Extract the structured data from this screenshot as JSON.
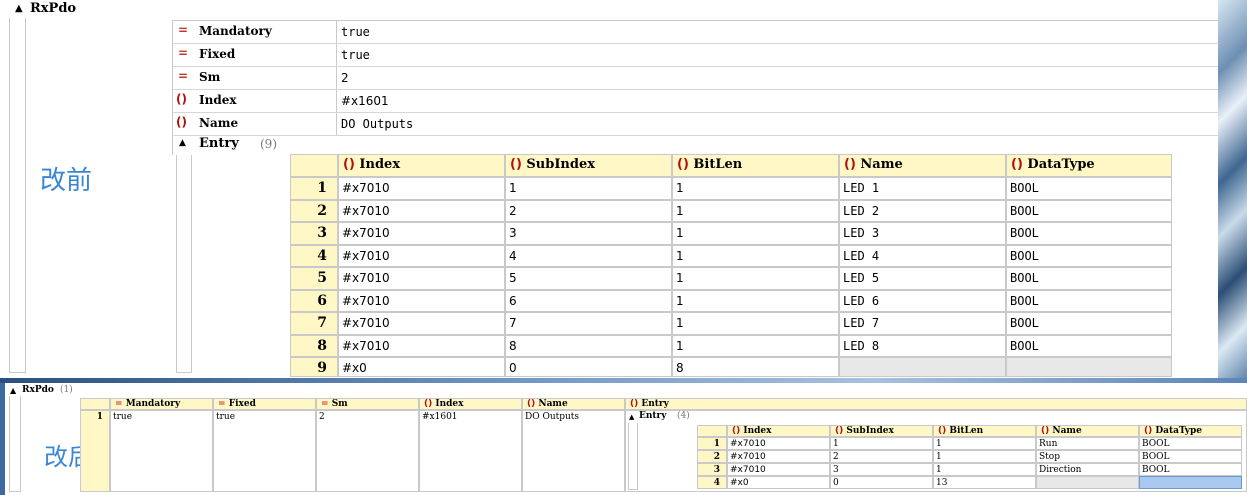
{
  "top": {
    "node_label": "RxPdo",
    "props": [
      {
        "icon": "=",
        "key": "Mandatory",
        "value": "true"
      },
      {
        "icon": "=",
        "key": "Fixed",
        "value": "true"
      },
      {
        "icon": "=",
        "key": "Sm",
        "value": "2"
      },
      {
        "icon": "()",
        "key": "Index",
        "value": "#x1601"
      },
      {
        "icon": "()",
        "key": "Name",
        "value": "DO Outputs"
      }
    ],
    "entry_label": "Entry",
    "entry_count": "(9)",
    "annotation": "改前",
    "columns": [
      "Index",
      "SubIndex",
      "BitLen",
      "Name",
      "DataType"
    ],
    "rows": [
      {
        "n": "1",
        "index": "#x7010",
        "sub": "1",
        "bitlen": "1",
        "name": "LED 1",
        "type": "BOOL"
      },
      {
        "n": "2",
        "index": "#x7010",
        "sub": "2",
        "bitlen": "1",
        "name": "LED 2",
        "type": "BOOL"
      },
      {
        "n": "3",
        "index": "#x7010",
        "sub": "3",
        "bitlen": "1",
        "name": "LED 3",
        "type": "BOOL"
      },
      {
        "n": "4",
        "index": "#x7010",
        "sub": "4",
        "bitlen": "1",
        "name": "LED 4",
        "type": "BOOL"
      },
      {
        "n": "5",
        "index": "#x7010",
        "sub": "5",
        "bitlen": "1",
        "name": "LED 5",
        "type": "BOOL"
      },
      {
        "n": "6",
        "index": "#x7010",
        "sub": "6",
        "bitlen": "1",
        "name": "LED 6",
        "type": "BOOL"
      },
      {
        "n": "7",
        "index": "#x7010",
        "sub": "7",
        "bitlen": "1",
        "name": "LED 7",
        "type": "BOOL"
      },
      {
        "n": "8",
        "index": "#x7010",
        "sub": "8",
        "bitlen": "1",
        "name": "LED 8",
        "type": "BOOL"
      },
      {
        "n": "9",
        "index": "#x0",
        "sub": "0",
        "bitlen": "8",
        "name": "",
        "type": ""
      }
    ]
  },
  "bottom": {
    "node_label": "RxPdo",
    "node_count": "(1)",
    "columns": [
      "Mandatory",
      "Fixed",
      "Sm",
      "Index",
      "Name",
      "Entry"
    ],
    "row": {
      "n": "1",
      "mandatory": "true",
      "fixed": "true",
      "sm": "2",
      "index": "#x1601",
      "name": "DO Outputs"
    },
    "entry_label": "Entry",
    "entry_count": "(4)",
    "annotation": "改后",
    "entry_columns": [
      "Index",
      "SubIndex",
      "BitLen",
      "Name",
      "DataType"
    ],
    "entry_rows": [
      {
        "n": "1",
        "index": "#x7010",
        "sub": "1",
        "bitlen": "1",
        "name": "Run",
        "type": "BOOL"
      },
      {
        "n": "2",
        "index": "#x7010",
        "sub": "2",
        "bitlen": "1",
        "name": "Stop",
        "type": "BOOL"
      },
      {
        "n": "3",
        "index": "#x7010",
        "sub": "3",
        "bitlen": "1",
        "name": "Direction",
        "type": "BOOL"
      },
      {
        "n": "4",
        "index": "#x0",
        "sub": "0",
        "bitlen": "13",
        "name": "",
        "type": ""
      }
    ]
  },
  "icons": {
    "eq": "=",
    "br": "()"
  },
  "colors": {
    "header_bg": "#fff8c6",
    "annotation": "#3a86d6",
    "selection": "#a9c8ee"
  }
}
